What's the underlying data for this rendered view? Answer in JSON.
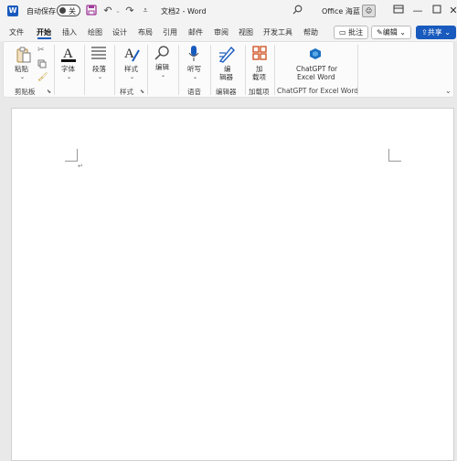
{
  "titlebar": {
    "autosave_label": "自动保存",
    "toggle_state": "关",
    "doc_title": "文档2 - Word",
    "user_name": "Office 海蓝"
  },
  "menu": {
    "tabs": [
      "文件",
      "开始",
      "插入",
      "绘图",
      "设计",
      "布局",
      "引用",
      "邮件",
      "审阅",
      "视图",
      "开发工具",
      "帮助"
    ],
    "active_tab": "开始",
    "comment_label": "批注",
    "edit_label": "编辑",
    "share_label": "共享"
  },
  "ribbon": {
    "paste_label": "粘贴",
    "clipboard_group": "剪贴板",
    "font_label": "字体",
    "paragraph_label": "段落",
    "styles_label": "样式",
    "styles_group": "样式",
    "editing_label": "编辑",
    "dictate_label": "听写",
    "voice_group": "语音",
    "editor_label_1": "编",
    "editor_label_2": "辑器",
    "editor_group": "编辑器",
    "addin_label_1": "加",
    "addin_label_2": "载项",
    "addin_group": "加载项",
    "chatgpt_label_1": "ChatGPT for",
    "chatgpt_label_2": "Excel Word",
    "chatgpt_group": "ChatGPT for Excel Word"
  },
  "colors": {
    "accent": "#185abd",
    "share_bg": "#185abd",
    "page_bg": "#ffffff",
    "window_bg": "#e9e9e9"
  }
}
